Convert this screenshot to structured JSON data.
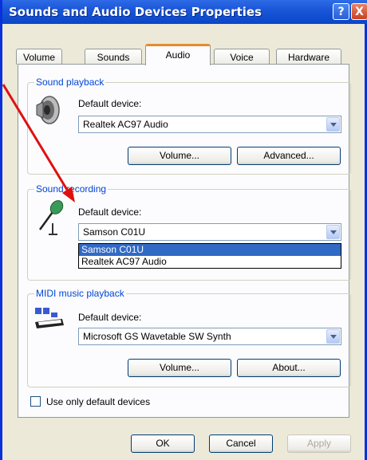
{
  "window": {
    "title": "Sounds and Audio Devices Properties",
    "help_glyph": "?",
    "close_glyph": "X",
    "tabs": [
      {
        "label": "Volume"
      },
      {
        "label": "Sounds"
      },
      {
        "label": "Audio"
      },
      {
        "label": "Voice"
      },
      {
        "label": "Hardware"
      }
    ],
    "active_tab": "Audio"
  },
  "playback": {
    "title": "Sound playback",
    "default_label": "Default device:",
    "device": "Realtek AC97 Audio",
    "volume_btn": "Volume...",
    "advanced_btn": "Advanced...",
    "icon": "speaker-icon"
  },
  "recording": {
    "title": "Sound recording",
    "default_label": "Default device:",
    "device": "Samson C01U",
    "icon": "microphone-icon",
    "dropdown_options": [
      "Samson C01U",
      "Realtek AC97 Audio"
    ]
  },
  "midi": {
    "title": "MIDI music playback",
    "default_label": "Default device:",
    "device": "Microsoft GS Wavetable SW Synth",
    "volume_btn": "Volume...",
    "about_btn": "About...",
    "icon": "keyboard-icon"
  },
  "use_default_label": "Use only default devices",
  "footer": {
    "ok": "OK",
    "cancel": "Cancel",
    "apply": "Apply"
  },
  "colors": {
    "accent": "#0046d5",
    "selection": "#316ac5",
    "annotation_arrow": "#e01010"
  }
}
